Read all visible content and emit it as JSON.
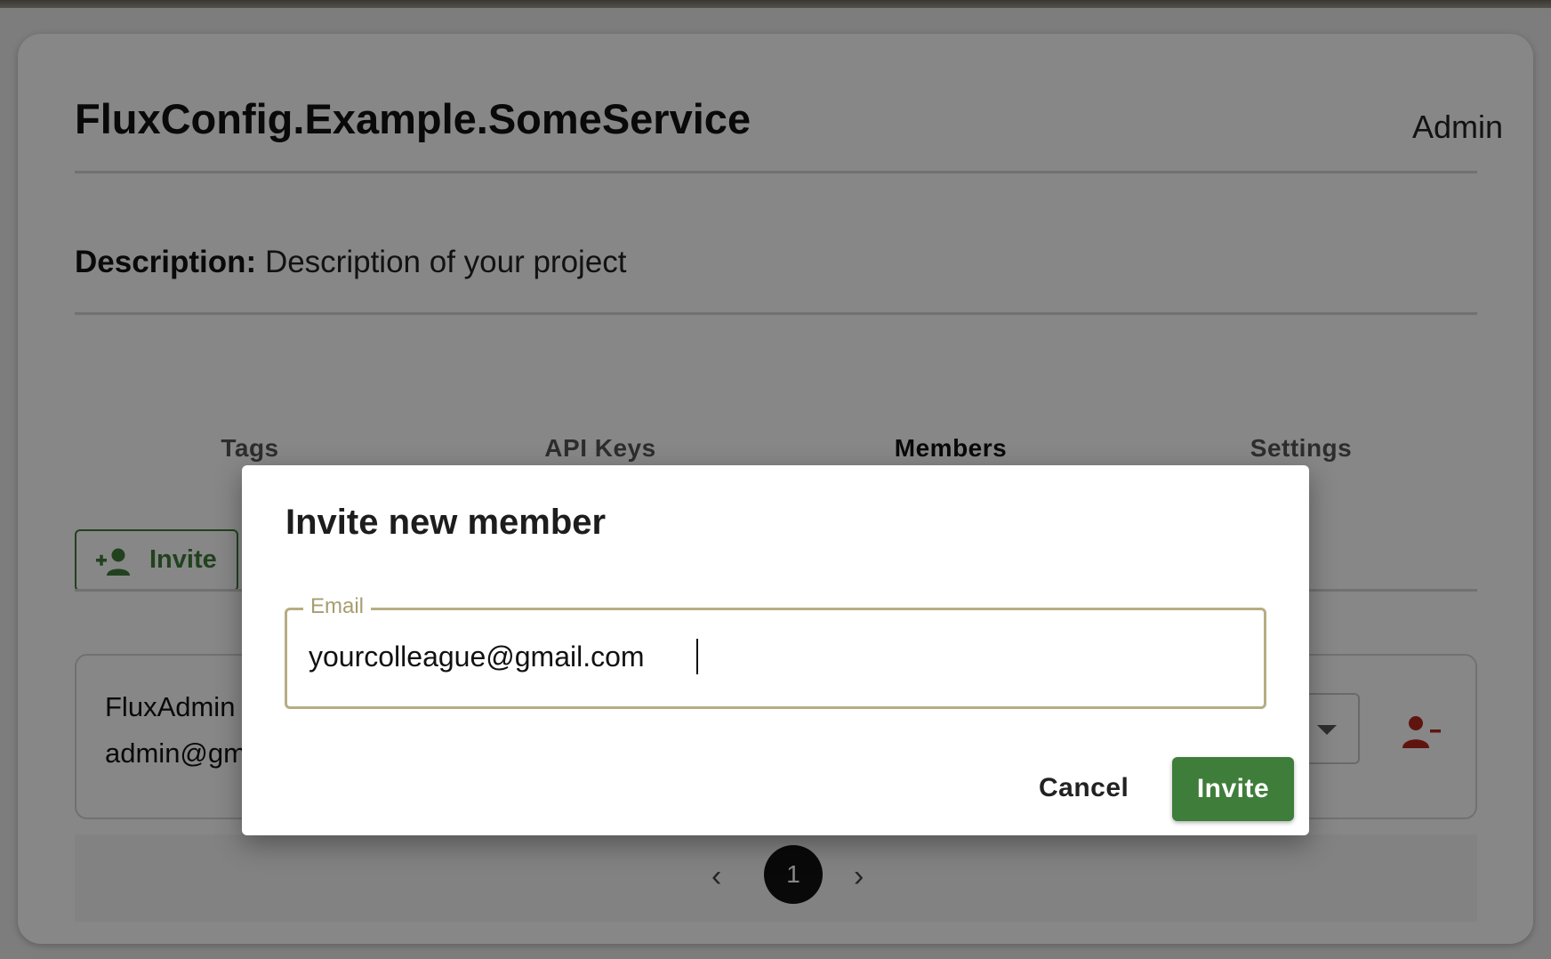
{
  "project": {
    "title": "FluxConfig.Example.SomeService",
    "role": "Admin",
    "description_label": "Description:",
    "description_text": "Description of your project"
  },
  "tabs": [
    {
      "label": "Tags"
    },
    {
      "label": "API Keys"
    },
    {
      "label": "Members",
      "active": true
    },
    {
      "label": "Settings"
    }
  ],
  "members_section": {
    "invite_button_label": "Invite",
    "members": [
      {
        "name": "FluxAdmin",
        "email": "admin@gm"
      }
    ],
    "pagination": {
      "prev": "‹",
      "current_page": "1",
      "next": "›"
    }
  },
  "dialog": {
    "title": "Invite new member",
    "email_label": "Email",
    "email_value": "yourcolleague@gmail.com",
    "cancel_label": "Cancel",
    "invite_label": "Invite"
  },
  "colors": {
    "accent_green": "#3f7d3a",
    "remove_red": "#b5271f",
    "field_border": "#b7ad83"
  },
  "icons": {
    "invite": "person-add-icon",
    "remove_member": "person-remove-icon",
    "dropdown": "caret-down-icon"
  }
}
